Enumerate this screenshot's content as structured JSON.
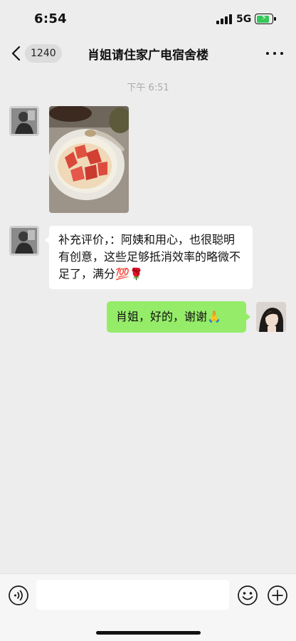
{
  "status_bar": {
    "time": "6:54",
    "network": "5G",
    "battery_state": "charging",
    "battery_color": "#34c759"
  },
  "nav": {
    "back_icon": "chevron-left-icon",
    "unread_count": "1240",
    "title": "肖姐请住家广电宿舍楼",
    "more_icon": "more-dots-icon"
  },
  "chat": {
    "timestamp": "下午 6:51",
    "messages": [
      {
        "from": "other",
        "type": "image",
        "image_subject": "bowl of strawberries and egg dish on a table"
      },
      {
        "from": "other",
        "type": "text",
        "text": "补充评价，：阿姨和用心，也很聪明有创意，这些足够抵消效率的略微不足了，满分💯🌹"
      },
      {
        "from": "self",
        "type": "text",
        "text": "肖姐，好的，谢谢🙏"
      }
    ]
  },
  "input_bar": {
    "voice_icon": "voice-input-icon",
    "emoji_icon": "emoji-icon",
    "plus_icon": "add-more-icon",
    "placeholder": ""
  },
  "colors": {
    "background": "#ededed",
    "outgoing_bubble": "#95ec69",
    "incoming_bubble": "#ffffff"
  }
}
